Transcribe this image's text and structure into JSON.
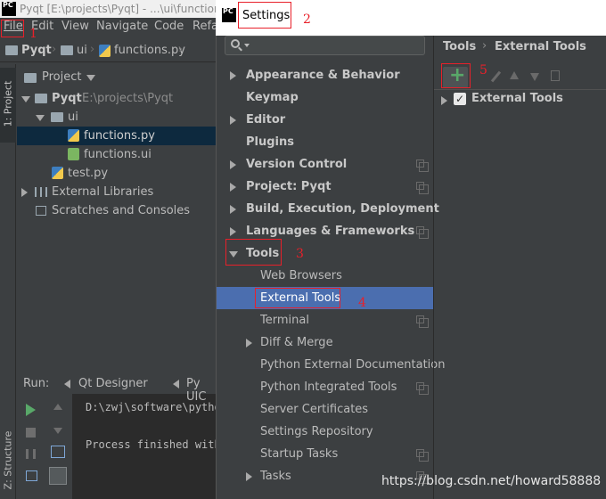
{
  "ide": {
    "title_text": "Pyqt [E:\\projects\\Pyqt] - ...\\ui\\functions",
    "logo_text": "PC",
    "menu": [
      "File",
      "Edit",
      "View",
      "Navigate",
      "Code",
      "Refa"
    ],
    "breadcrumbs": [
      "Pyqt",
      "ui",
      "functions.py"
    ]
  },
  "project_panel": {
    "header": "Project",
    "side_tab": "1: Project",
    "tree": [
      {
        "label": "Pyqt",
        "path": "E:\\projects\\Pyqt"
      },
      {
        "label": "ui"
      },
      {
        "label": "functions.py"
      },
      {
        "label": "functions.ui"
      },
      {
        "label": "test.py"
      },
      {
        "label": "External Libraries"
      },
      {
        "label": "Scratches and Consoles"
      }
    ]
  },
  "run_panel": {
    "label": "Run:",
    "tabs": [
      "Qt Designer",
      "Py UIC"
    ],
    "console_lines": [
      "D:\\zwj\\software\\pytho",
      "Process finished with"
    ],
    "side_tab": "Z: Structure"
  },
  "settings": {
    "title": "Settings",
    "logo_text": "PC",
    "search_placeholder": "",
    "nav": [
      {
        "label": "Appearance & Behavior"
      },
      {
        "label": "Keymap"
      },
      {
        "label": "Editor"
      },
      {
        "label": "Plugins"
      },
      {
        "label": "Version Control"
      },
      {
        "label": "Project: Pyqt"
      },
      {
        "label": "Build, Execution, Deployment"
      },
      {
        "label": "Languages & Frameworks"
      },
      {
        "label": "Tools"
      },
      {
        "label": "Web Browsers"
      },
      {
        "label": "External Tools"
      },
      {
        "label": "Terminal"
      },
      {
        "label": "Diff & Merge"
      },
      {
        "label": "Python External Documentation"
      },
      {
        "label": "Python Integrated Tools"
      },
      {
        "label": "Server Certificates"
      },
      {
        "label": "Settings Repository"
      },
      {
        "label": "Startup Tasks"
      },
      {
        "label": "Tasks"
      }
    ],
    "right_breadcrumb": [
      "Tools",
      "External Tools"
    ],
    "add_glyph": "+",
    "tree_item": "External Tools",
    "tree_item_checked": true
  },
  "annotations": [
    "1",
    "2",
    "3",
    "4",
    "5"
  ],
  "watermark": "https://blog.csdn.net/howard58888",
  "colors": {
    "accent_selection": "#4b6eaf",
    "project_selection": "#0d293e",
    "annotation_red": "#e8202a",
    "add_green": "#59a869"
  }
}
